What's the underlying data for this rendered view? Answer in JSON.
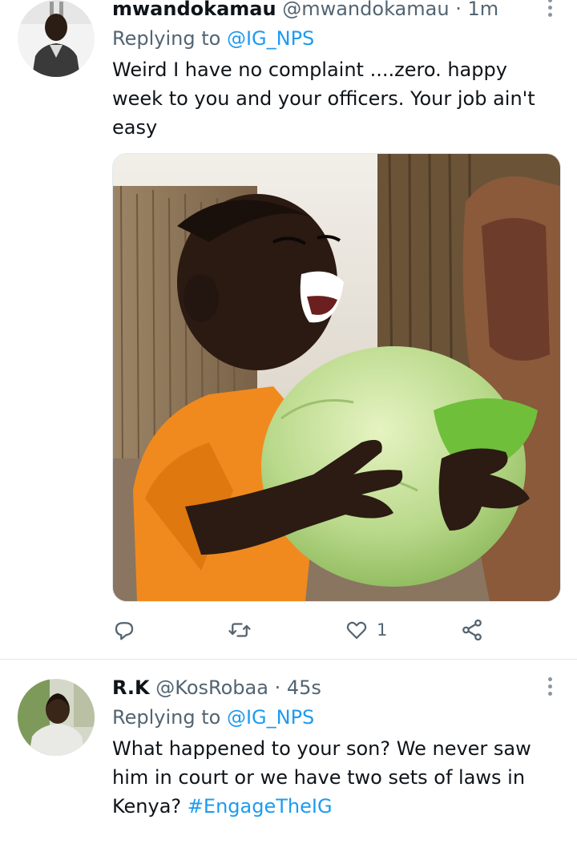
{
  "tweets": [
    {
      "name": "mwandokamau",
      "handle": "@mwandokamau",
      "dot": "·",
      "time": "1m",
      "replying_prefix": "Replying to ",
      "replying_to": "@IG_NPS",
      "text": "Weird I have no complaint ....zero. happy week to you and your officers. Your job ain't easy",
      "media": "photo of a laughing child holding a large cabbage",
      "actions": {
        "reply_count": "",
        "retweet_count": "",
        "like_count": "1"
      }
    },
    {
      "name": "R.K",
      "handle": "@KosRobaa",
      "dot": "·",
      "time": "45s",
      "replying_prefix": "Replying to ",
      "replying_to": "@IG_NPS",
      "text": "What happened to your son? We never saw him in court or we have two sets of laws in Kenya? ",
      "hashtag": "#EngageTheIG"
    }
  ],
  "colors": {
    "link": "#1d9bf0",
    "secondary": "#536471",
    "text": "#0f1419"
  },
  "icons": [
    "more-icon",
    "reply-icon",
    "retweet-icon",
    "like-icon",
    "share-icon"
  ]
}
